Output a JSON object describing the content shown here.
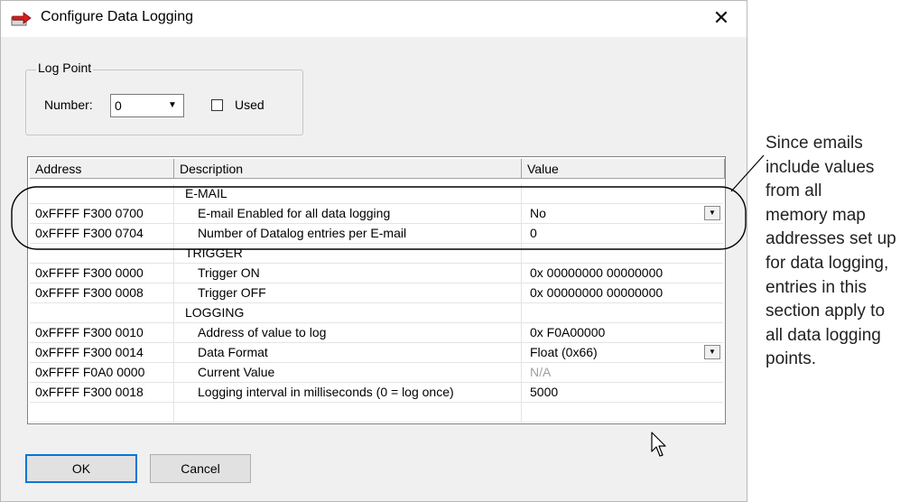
{
  "dialog": {
    "title": "Configure Data Logging",
    "close_glyph": "✕",
    "icon": "data-logging-icon"
  },
  "log_point": {
    "legend": "Log Point",
    "number_label": "Number:",
    "number_value": "0",
    "used_label": "Used",
    "used_checked": false
  },
  "grid": {
    "columns": [
      "Address",
      "Description",
      "Value"
    ],
    "rows": [
      {
        "address": "",
        "description": "E-MAIL",
        "value": "",
        "kind": "section"
      },
      {
        "address": "0xFFFF F300 0700",
        "description": "E-mail Enabled for all data logging",
        "value": "No",
        "kind": "item",
        "dropdown": true
      },
      {
        "address": "0xFFFF F300 0704",
        "description": "Number of Datalog entries per E-mail",
        "value": "0",
        "kind": "item"
      },
      {
        "address": "",
        "description": "TRIGGER",
        "value": "",
        "kind": "section"
      },
      {
        "address": "0xFFFF F300 0000",
        "description": "Trigger ON",
        "value": "0x 00000000  00000000",
        "kind": "item"
      },
      {
        "address": "0xFFFF F300 0008",
        "description": "Trigger OFF",
        "value": "0x 00000000  00000000",
        "kind": "item"
      },
      {
        "address": "",
        "description": "LOGGING",
        "value": "",
        "kind": "section"
      },
      {
        "address": "0xFFFF F300 0010",
        "description": "Address of value to log",
        "value": "0x F0A00000",
        "kind": "item"
      },
      {
        "address": "0xFFFF F300 0014",
        "description": "Data Format",
        "value": "Float (0x66)",
        "kind": "item",
        "dropdown": true
      },
      {
        "address": "0xFFFF F0A0 0000",
        "description": "Current Value",
        "value": "N/A",
        "kind": "item",
        "disabled": true
      },
      {
        "address": "0xFFFF F300 0018",
        "description": "Logging interval in milliseconds (0 = log once)",
        "value": "5000",
        "kind": "item"
      },
      {
        "address": "",
        "description": "",
        "value": "",
        "kind": "empty"
      }
    ]
  },
  "buttons": {
    "ok": "OK",
    "cancel": "Cancel"
  },
  "annotation": {
    "lines": [
      "Since emails",
      "include values",
      "from all",
      "memory map",
      "addresses set up",
      "for data logging,",
      "entries in this",
      "section apply to",
      "all data logging",
      "points."
    ]
  }
}
